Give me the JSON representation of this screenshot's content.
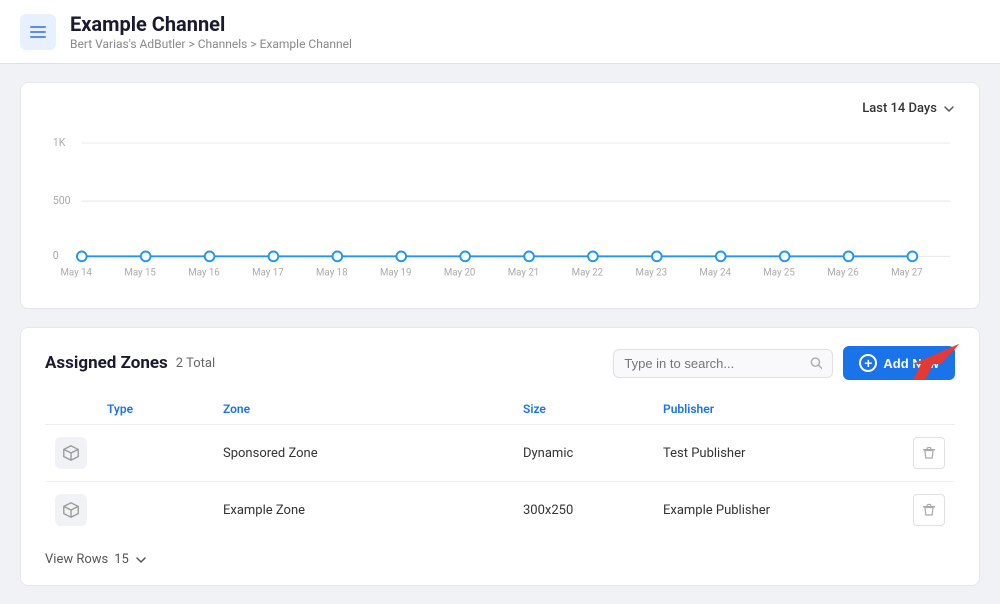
{
  "header": {
    "title": "Example Channel",
    "breadcrumb": "Bert Varias's AdButler > Channels > Example Channel",
    "icon_label": "menu-icon"
  },
  "chart": {
    "date_filter_label": "Last 14 Days",
    "y_labels": [
      "1K",
      "500",
      "0"
    ],
    "x_labels": [
      "May 14",
      "May 15",
      "May 16",
      "May 17",
      "May 18",
      "May 19",
      "May 20",
      "May 21",
      "May 22",
      "May 23",
      "May 24",
      "May 25",
      "May 26",
      "May 27"
    ]
  },
  "zones_section": {
    "title": "Assigned Zones",
    "total_label": "2 Total",
    "search_placeholder": "Type in to search...",
    "add_button_label": "Add New",
    "columns": [
      "Type",
      "Zone",
      "Size",
      "Publisher"
    ],
    "rows": [
      {
        "type_icon": "box-icon",
        "zone": "Sponsored Zone",
        "size": "Dynamic",
        "publisher": "Test Publisher"
      },
      {
        "type_icon": "box-icon",
        "zone": "Example Zone",
        "size": "300x250",
        "publisher": "Example Publisher"
      }
    ],
    "footer_label": "View Rows",
    "footer_value": "15"
  }
}
